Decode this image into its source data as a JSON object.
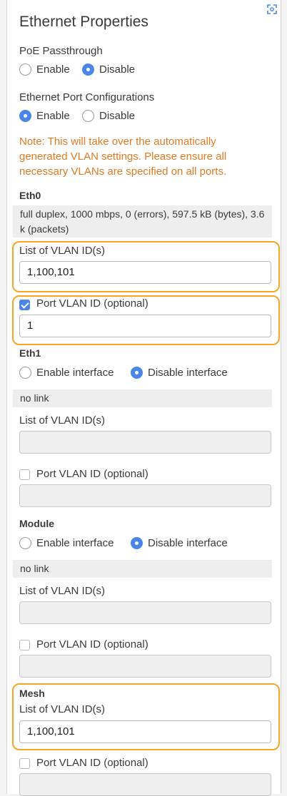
{
  "panel": {
    "title": "Ethernet Properties"
  },
  "poe": {
    "label": "PoE Passthrough",
    "options": [
      "Enable",
      "Disable"
    ],
    "selected": "Disable"
  },
  "port_config": {
    "label": "Ethernet Port Configurations",
    "options": [
      "Enable",
      "Disable"
    ],
    "selected": "Enable",
    "note": "Note: This will take over the automatically generated VLAN settings. Please ensure all necessary VLANs are specified on all ports."
  },
  "eth0": {
    "name": "Eth0",
    "status": "full duplex, 1000 mbps, 0 (errors), 597.5 kB (bytes), 3.6 k (packets)",
    "vlan_label": "List of VLAN ID(s)",
    "vlan_value": "1,100,101",
    "port_vlan_label": "Port VLAN ID (optional)",
    "port_vlan_checked": true,
    "port_vlan_value": "1"
  },
  "eth1": {
    "name": "Eth1",
    "options": [
      "Enable interface",
      "Disable interface"
    ],
    "selected": "Disable interface",
    "status": "no link",
    "vlan_label": "List of VLAN ID(s)",
    "vlan_value": "",
    "port_vlan_label": "Port VLAN ID (optional)",
    "port_vlan_checked": false,
    "port_vlan_value": ""
  },
  "module": {
    "name": "Module",
    "options": [
      "Enable interface",
      "Disable interface"
    ],
    "selected": "Disable interface",
    "status": "no link",
    "vlan_label": "List of VLAN ID(s)",
    "vlan_value": "",
    "port_vlan_label": "Port VLAN ID (optional)",
    "port_vlan_checked": false,
    "port_vlan_value": ""
  },
  "mesh": {
    "name": "Mesh",
    "vlan_label": "List of VLAN ID(s)",
    "vlan_value": "1,100,101",
    "port_vlan_label": "Port VLAN ID (optional)",
    "port_vlan_checked": false,
    "port_vlan_value": ""
  },
  "colors": {
    "accent": "#4a86e8",
    "note": "#e07a22",
    "highlight": "#f5a623"
  },
  "icons": {
    "expand": "expand-icon"
  }
}
